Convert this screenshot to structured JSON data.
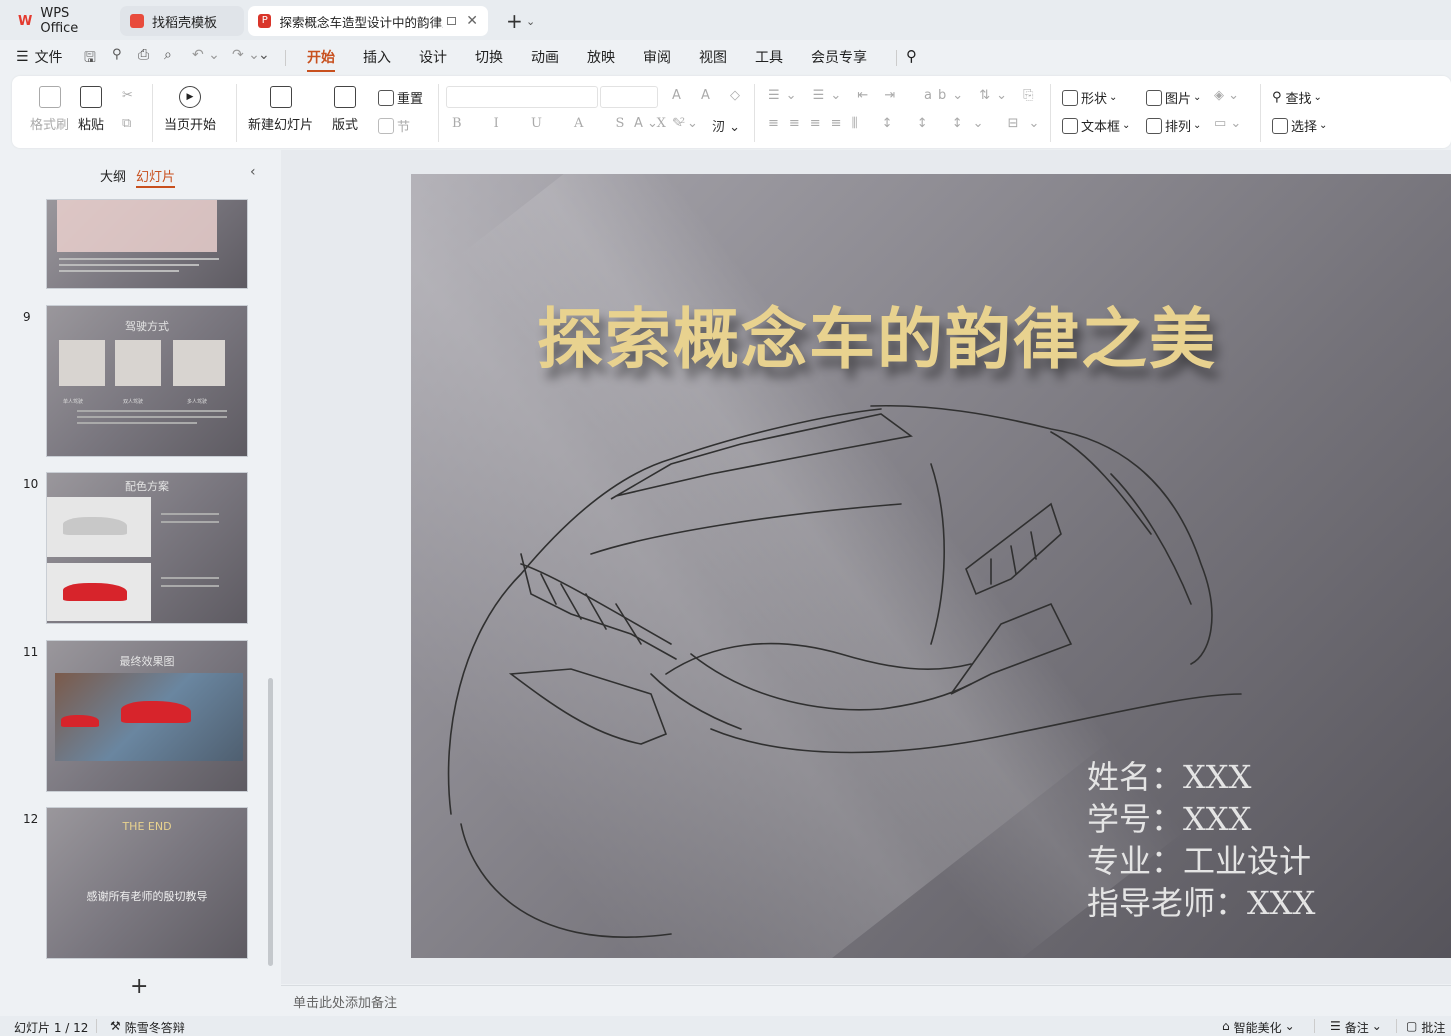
{
  "tabs": [
    {
      "label": "WPS Office"
    },
    {
      "label": "找稻壳模板"
    },
    {
      "label": "探索概念车造型设计中的韵律之"
    }
  ],
  "menu": {
    "file": "文件",
    "items": [
      "开始",
      "插入",
      "设计",
      "切换",
      "动画",
      "放映",
      "审阅",
      "视图",
      "工具",
      "会员专享"
    ]
  },
  "ribbon": {
    "format_painter": "格式刷",
    "paste": "粘贴",
    "start_from_current": "当页开始",
    "new_slide": "新建幻灯片",
    "layout": "版式",
    "reset": "重置",
    "section": "节",
    "shape": "形状",
    "picture": "图片",
    "textbox": "文本框",
    "arrange": "排列",
    "find": "查找",
    "select": "选择"
  },
  "panel": {
    "outline_tab": "大纲",
    "slides_tab": "幻灯片",
    "add": "+"
  },
  "thumbnails": [
    {
      "num": "9",
      "title": "驾驶方式",
      "labels": [
        "单人驾驶",
        "双人驾驶",
        "多人驾驶"
      ]
    },
    {
      "num": "10",
      "title": "配色方案"
    },
    {
      "num": "11",
      "title": "最终效果图"
    },
    {
      "num": "12",
      "title": "THE  END",
      "text": "感谢所有老师的殷切教导"
    }
  ],
  "slide": {
    "title": "探索概念车的韵律之美",
    "info": [
      "姓名：XXX",
      "学号：XXX",
      "专业：工业设计",
      "指导老师：XXX"
    ]
  },
  "notes_placeholder": "单击此处添加备注",
  "status": {
    "slide_counter": "幻灯片 1 / 12",
    "theme": "陈雪冬答辩",
    "beautify": "智能美化",
    "notes": "备注",
    "comments": "批注"
  },
  "colors": {
    "accent": "#c8501e",
    "title_gold": "#e8d28f"
  }
}
